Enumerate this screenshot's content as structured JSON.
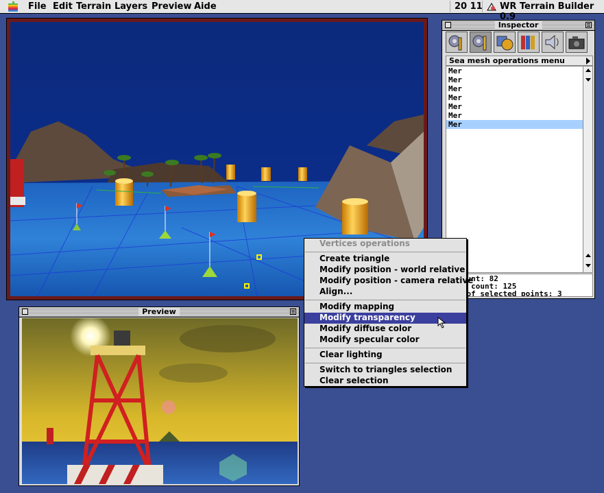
{
  "menubar": {
    "items": [
      "File",
      "Edit",
      "Terrain",
      "Layers",
      "Preview",
      "Aide"
    ],
    "clock": "20 11",
    "app_name": "WR Terrain Builder 0.9"
  },
  "preview_window": {
    "title": "Preview"
  },
  "inspector": {
    "title": "Inspector",
    "tools": [
      "gear-wrench-icon",
      "gear-pencil-icon",
      "cube-sphere-icon",
      "books-icon",
      "speaker-icon",
      "camera-icon"
    ],
    "menu_label": "Sea mesh operations menu",
    "list_items": [
      "Mer",
      "Mer",
      "Mer",
      "Mer",
      "Mer",
      "Mer",
      "Mer"
    ],
    "selected_index": 6,
    "stats": [
      "t count: 82",
      "ngle count: 125",
      "ber of selected points: 3"
    ]
  },
  "context_menu": {
    "header": "Vertices operations",
    "groups": [
      [
        "Create triangle",
        "Modify position - world relative",
        "Modify position - camera relative",
        "Align..."
      ],
      [
        "Modify mapping",
        "Modify transparency",
        "Modify diffuse color",
        "Modify specular color"
      ],
      [
        "Clear lighting"
      ],
      [
        "Switch to triangles selection",
        "Clear selection"
      ]
    ],
    "highlighted": "Modify transparency"
  },
  "colors": {
    "desktop": "#3a4e92",
    "highlight": "#3b3f9e",
    "selection": "#a8d0ff"
  }
}
